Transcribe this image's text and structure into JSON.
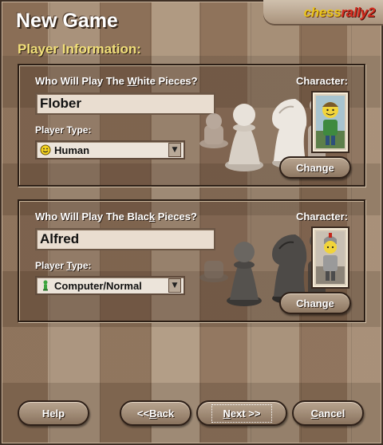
{
  "window": {
    "title": "New Game",
    "logo_part1": "chess",
    "logo_part2": "rally2"
  },
  "section_title": "Player Information:",
  "white": {
    "question_pre": "Who Will Play The ",
    "question_accel": "W",
    "question_post": "hite Pieces?",
    "character_label": "Character:",
    "name_value": "Flober",
    "player_type_label": "Player Type:",
    "player_type_value": "Human",
    "player_type_icon": "smiley-icon",
    "change_label": "Change"
  },
  "black": {
    "question_pre": "Who Will Play The Blac",
    "question_accel": "k",
    "question_post": " Pieces?",
    "character_label": "Character:",
    "name_value": "Alfred",
    "player_type_label_pre": "Player ",
    "player_type_label_accel": "T",
    "player_type_label_post": "ype:",
    "player_type_value": "Computer/Normal",
    "player_type_icon": "computer-figure-icon",
    "change_label": "Change"
  },
  "buttons": {
    "help": "Help",
    "back_pre": "<< ",
    "back_accel": "B",
    "back_post": "ack",
    "next_accel": "N",
    "next_post": "ext >>",
    "cancel_accel": "C",
    "cancel_post": "ancel"
  },
  "colors": {
    "accent_title": "#f2e07a",
    "logo_yellow": "#e9c51c",
    "logo_red": "#d62b1e"
  }
}
